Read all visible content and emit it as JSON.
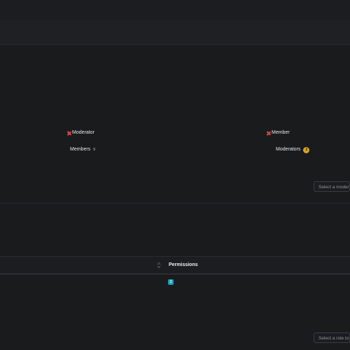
{
  "roles_section": {
    "role_chips": [
      {
        "label": "Moderator"
      },
      {
        "label": "Member"
      }
    ],
    "members_label": "Members",
    "members_count": "0",
    "moderators_label": "Moderators",
    "moderators_count": "2",
    "moderator_select_placeholder": "Select a moderator"
  },
  "permissions_table": {
    "header": "Permissions",
    "row_badge": "2"
  },
  "role_select_placeholder": "Select a role to"
}
